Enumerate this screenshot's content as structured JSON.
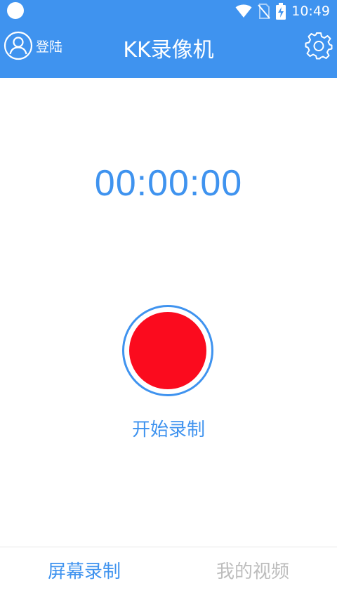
{
  "status_bar": {
    "time": "10:49",
    "icons": [
      "notification-dot-icon",
      "wifi-icon",
      "no-sim-icon",
      "battery-charging-icon"
    ]
  },
  "app_bar": {
    "login_label": "登陆",
    "title": "KK录像机",
    "login_icon": "user-icon",
    "settings_icon": "gear-icon"
  },
  "main": {
    "timer": "00:00:00",
    "record_label": "开始录制",
    "record_icon": "record-button"
  },
  "bottom_nav": {
    "tabs": [
      {
        "label": "屏幕录制",
        "active": true
      },
      {
        "label": "我的视频",
        "active": false
      }
    ]
  },
  "colors": {
    "primary": "#3f93ef",
    "record_red": "#fb0b1e",
    "inactive_text": "#bdbdbd",
    "divider": "#e6e6e6"
  }
}
